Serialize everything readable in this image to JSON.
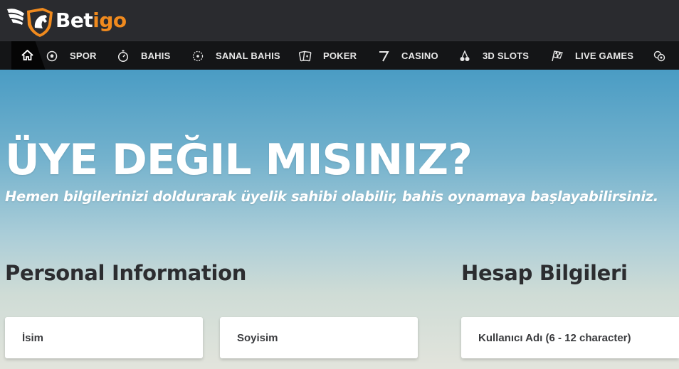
{
  "header": {
    "logo": {
      "part1": "Bet",
      "part2": "igo"
    }
  },
  "nav": {
    "items": [
      {
        "label": "SPOR",
        "icon": "soccer-ball-icon"
      },
      {
        "label": "BAHIS",
        "icon": "stopwatch-icon"
      },
      {
        "label": "SANAL BAHIS",
        "icon": "virtual-ball-icon"
      },
      {
        "label": "POKER",
        "icon": "cards-icon"
      },
      {
        "label": "CASINO",
        "icon": "seven-icon"
      },
      {
        "label": "3D SLOTS",
        "icon": "cherry-icon"
      },
      {
        "label": "LIVE GAMES",
        "icon": "checkered-flag-icon"
      }
    ]
  },
  "hero": {
    "title": "ÜYE DEĞIL MISINIZ?",
    "subtitle": "Hemen bilgilerinizi doldurarak üyelik sahibi olabilir, bahis oynamaya başlayabilirsiniz."
  },
  "personal": {
    "title": "Personal Information",
    "first_name_placeholder": "İsim",
    "last_name_placeholder": "Soyisim"
  },
  "account": {
    "title": "Hesap Bilgileri",
    "username_placeholder": "Kullanıcı Adı (6 - 12 character)"
  },
  "colors": {
    "brand_orange": "#f08a1e",
    "header_bg": "#2a2b2f",
    "nav_bg": "#141517"
  }
}
